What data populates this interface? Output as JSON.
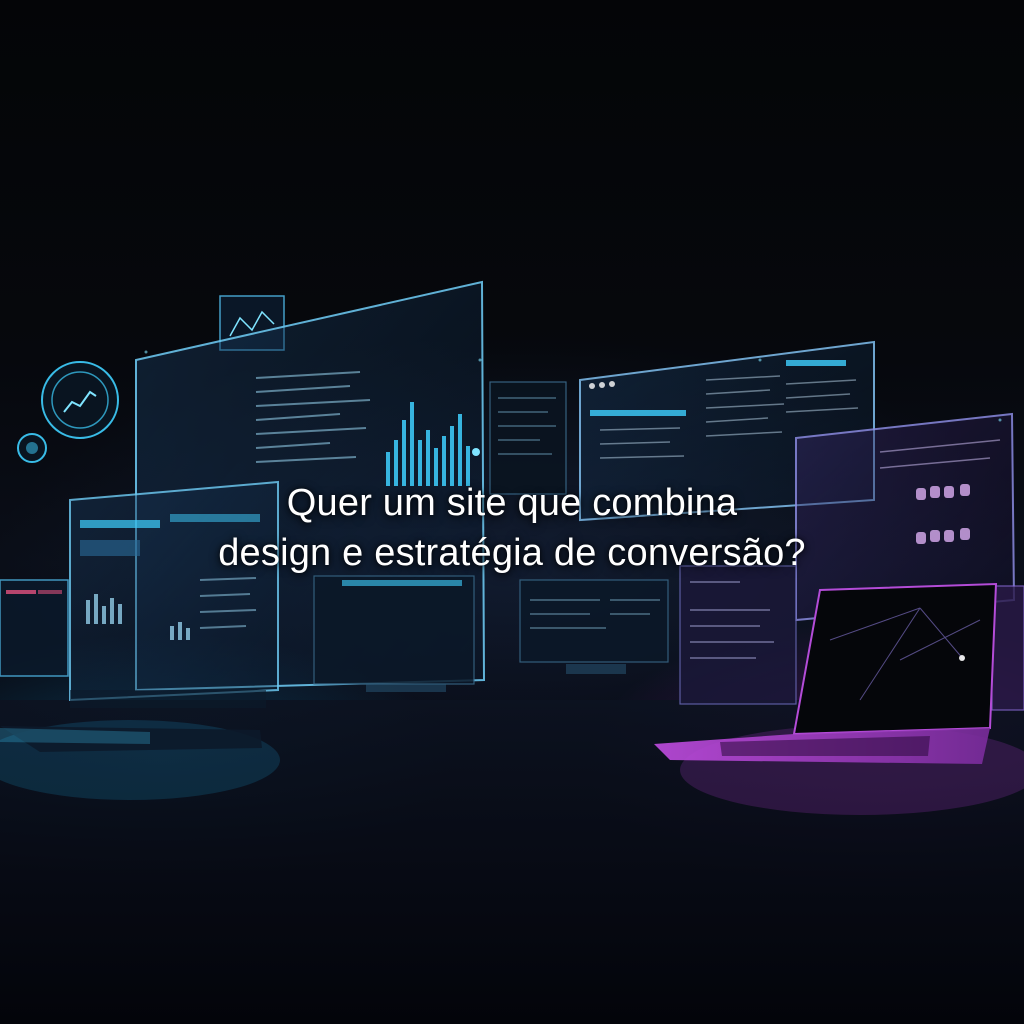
{
  "headline": {
    "line1": "Quer um site que combina",
    "line2": "design e estratégia de conversão?"
  },
  "colors": {
    "cyan": "#3fd0ff",
    "magenta": "#c04ce0",
    "background": "#05070b"
  },
  "icons": [
    "chart-badge-icon",
    "laptop-icon",
    "dashboard-screen-icon"
  ]
}
